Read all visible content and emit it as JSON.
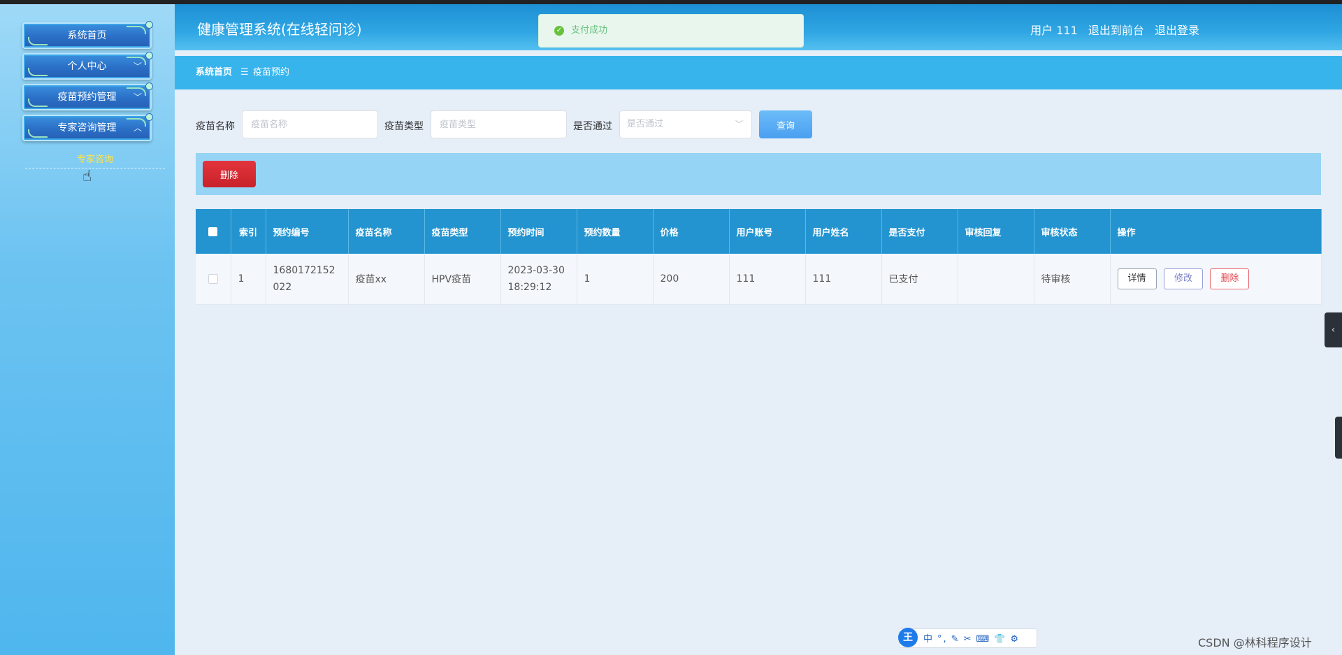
{
  "app": {
    "title": "健康管理系统(在线轻问诊)"
  },
  "header": {
    "user_label": "用户 111",
    "front_link": "退出到前台",
    "logout_link": "退出登录"
  },
  "toast": {
    "message": "支付成功",
    "icon": "check-circle-icon"
  },
  "sidebar": {
    "items": [
      {
        "label": "系统首页",
        "chevron": ""
      },
      {
        "label": "个人中心",
        "chevron": "﹀"
      },
      {
        "label": "疫苗预约管理",
        "chevron": "﹀"
      },
      {
        "label": "专家咨询管理",
        "chevron": "︿"
      }
    ],
    "submenu": {
      "label": "专家咨询"
    }
  },
  "breadcrumb": {
    "home": "系统首页",
    "separator": "☰",
    "current": "疫苗预约"
  },
  "search": {
    "name_label": "疫苗名称",
    "name_placeholder": "疫苗名称",
    "type_label": "疫苗类型",
    "type_placeholder": "疫苗类型",
    "passed_label": "是否通过",
    "passed_placeholder": "是否通过",
    "query_button": "查询"
  },
  "actions": {
    "batch_delete": "删除"
  },
  "table": {
    "columns": [
      "索引",
      "预约编号",
      "疫苗名称",
      "疫苗类型",
      "预约时间",
      "预约数量",
      "价格",
      "用户账号",
      "用户姓名",
      "是否支付",
      "审核回复",
      "审核状态",
      "操作"
    ],
    "rows": [
      {
        "index": "1",
        "booking_no": "1680172152022",
        "vaccine_name": "疫苗xx",
        "vaccine_type": "HPV疫苗",
        "booking_time": "2023-03-30 18:29:12",
        "quantity": "1",
        "price": "200",
        "account": "111",
        "user_name": "111",
        "paid": "已支付",
        "reply": "",
        "review_status": "待审核",
        "ops": {
          "detail": "详情",
          "edit": "修改",
          "delete": "删除"
        }
      }
    ]
  },
  "ime": {
    "logo": "王",
    "items": [
      "中",
      "°,",
      "✎",
      "✂",
      "⌨",
      "👕",
      "⚙"
    ]
  },
  "watermark": "CSDN @林科程序设计"
}
